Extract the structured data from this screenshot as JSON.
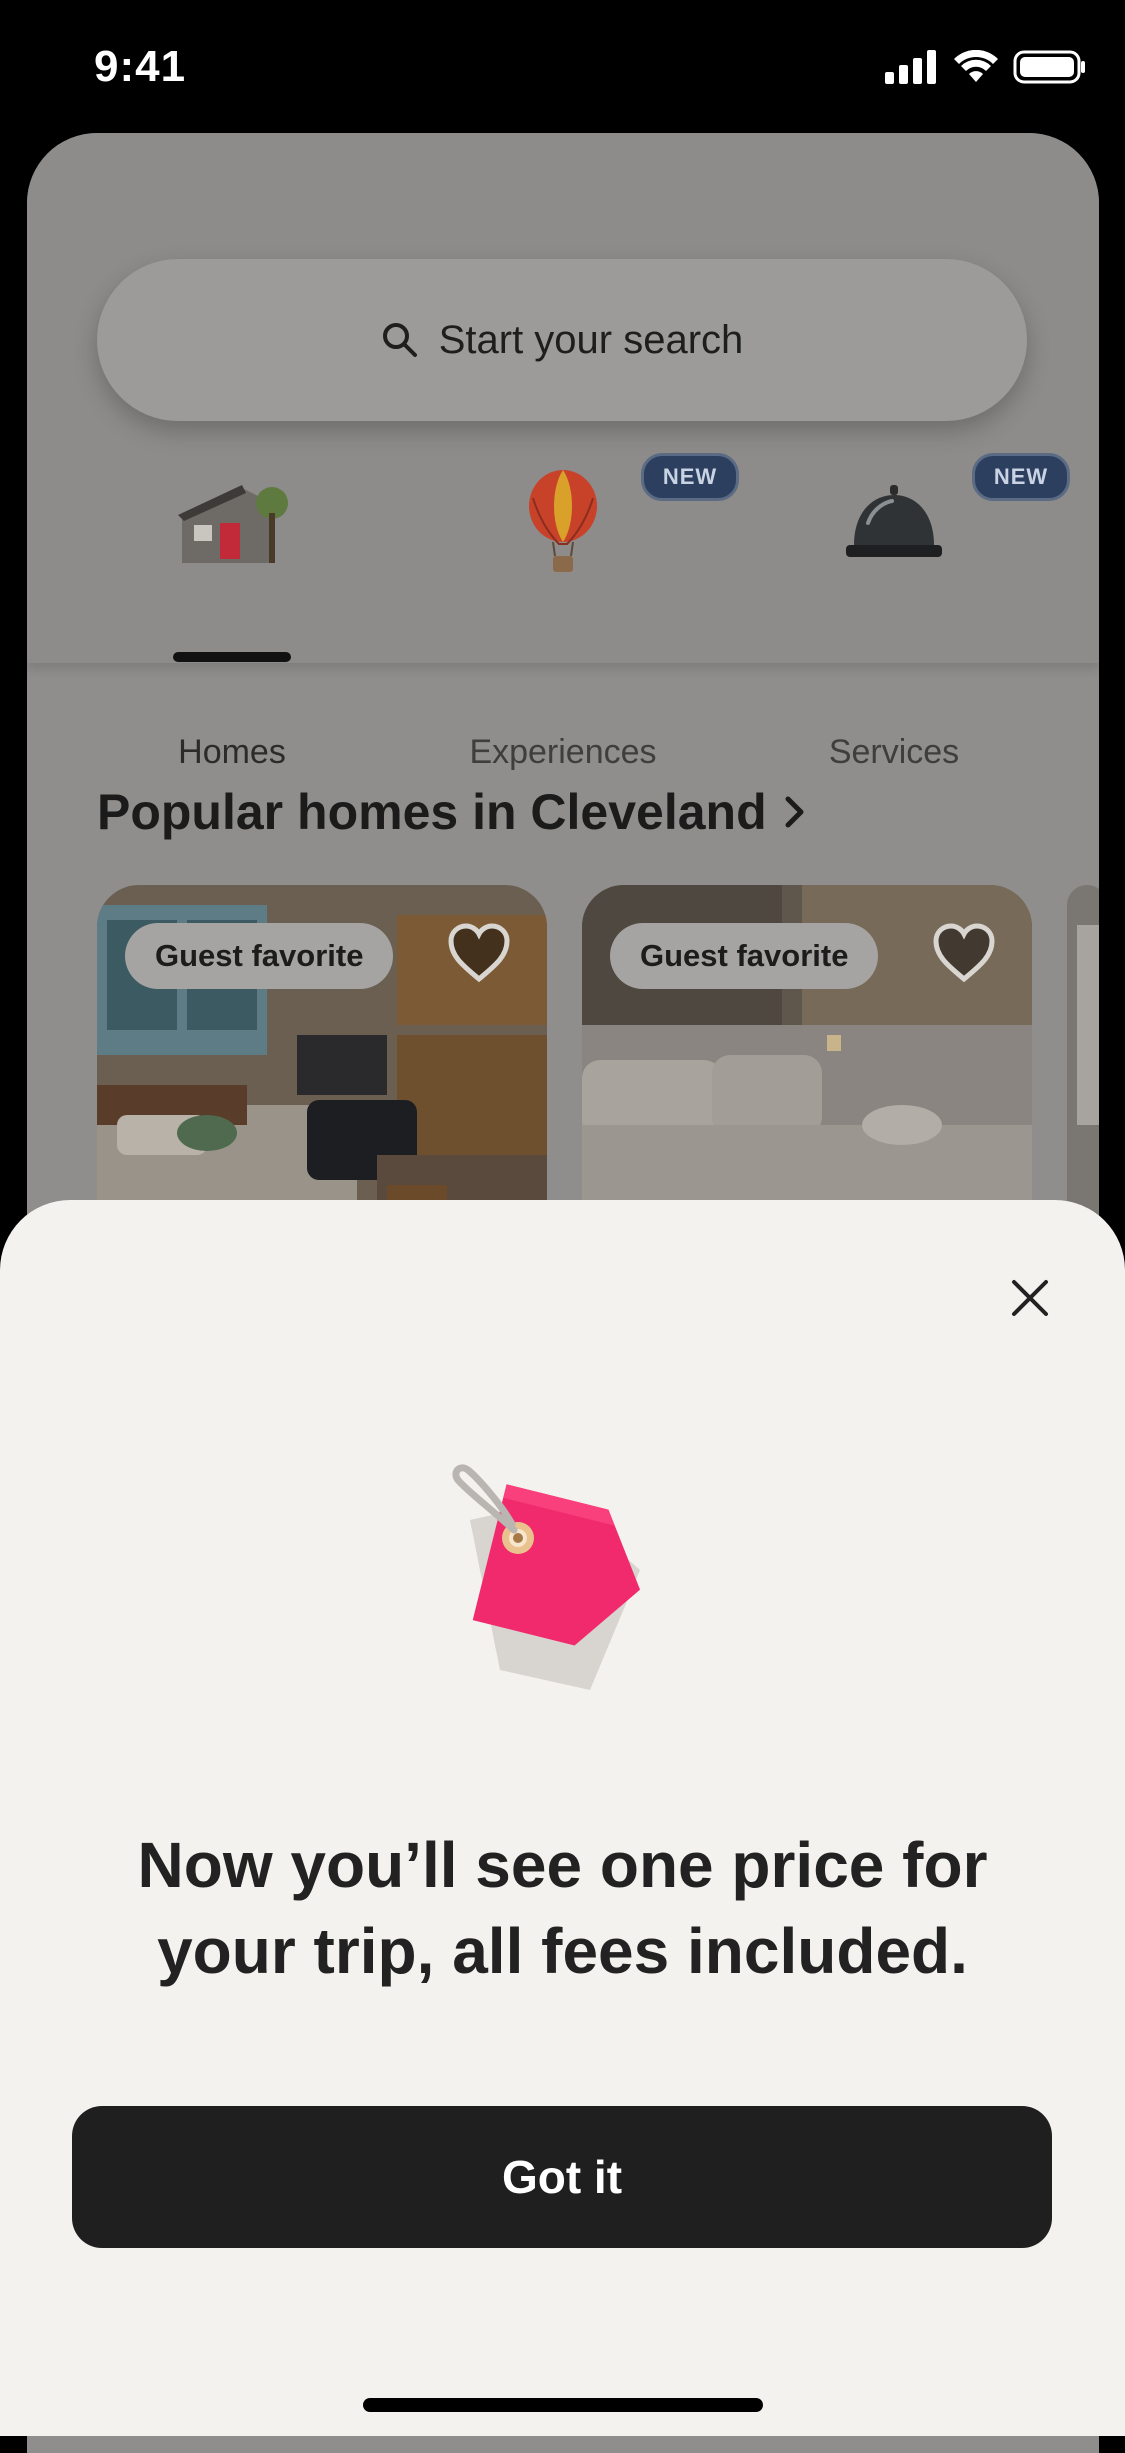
{
  "status_bar": {
    "time": "9:41",
    "icons": [
      "signal-icon",
      "wifi-icon",
      "battery-icon"
    ]
  },
  "search": {
    "placeholder": "Start your search"
  },
  "categories": [
    {
      "label": "Homes",
      "selected": true,
      "icon": "house-icon",
      "badge": ""
    },
    {
      "label": "Experiences",
      "selected": false,
      "icon": "hot-air-balloon-icon",
      "badge": "NEW"
    },
    {
      "label": "Services",
      "selected": false,
      "icon": "service-bell-icon",
      "badge": "NEW"
    }
  ],
  "section": {
    "title": "Popular homes in Cleveland"
  },
  "listings": [
    {
      "badge": "Guest favorite"
    },
    {
      "badge": "Guest favorite"
    }
  ],
  "sheet": {
    "headline_line1": "Now you’ll see one price for",
    "headline_line2": "your trip, all fees included.",
    "button": "Got it",
    "icon": "price-tag-icon"
  },
  "colors": {
    "accent_pink": "#f02a6c",
    "button_bg": "#1f1f1f",
    "sheet_bg": "#f4f2ef",
    "badge_blue": "#2c3f5e"
  }
}
